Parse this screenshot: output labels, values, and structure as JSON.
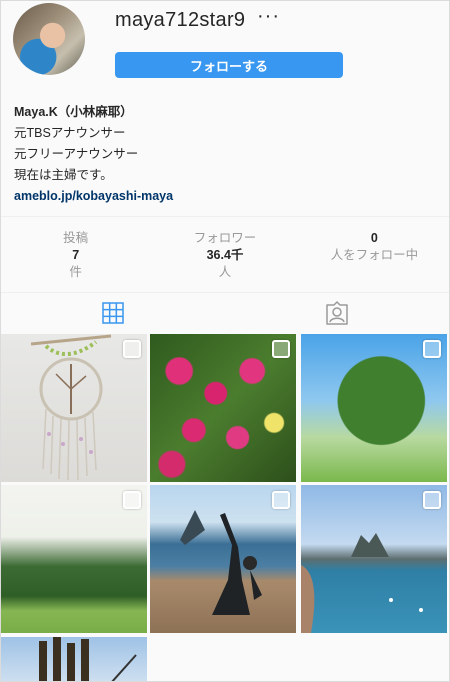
{
  "profile": {
    "username": "maya712star9",
    "more_label": "···",
    "follow_label": "フォローする"
  },
  "bio": {
    "name": "Maya.K（小林麻耶）",
    "line1": "元TBSアナウンサー",
    "line2": "元フリーアナウンサー",
    "line3": "現在は主婦です。",
    "link": "ameblo.jp/kobayashi-maya"
  },
  "stats": {
    "posts": {
      "label": "投稿",
      "value": "7",
      "unit": "件"
    },
    "followers": {
      "label": "フォロワー",
      "value": "36.4千",
      "unit": "人"
    },
    "following": {
      "value": "0",
      "label": "人をフォロー中"
    }
  },
  "tabs": [
    "grid-icon",
    "tagged-icon"
  ],
  "colors": {
    "accent": "#3897f0",
    "link": "#003569",
    "muted": "#999999"
  }
}
